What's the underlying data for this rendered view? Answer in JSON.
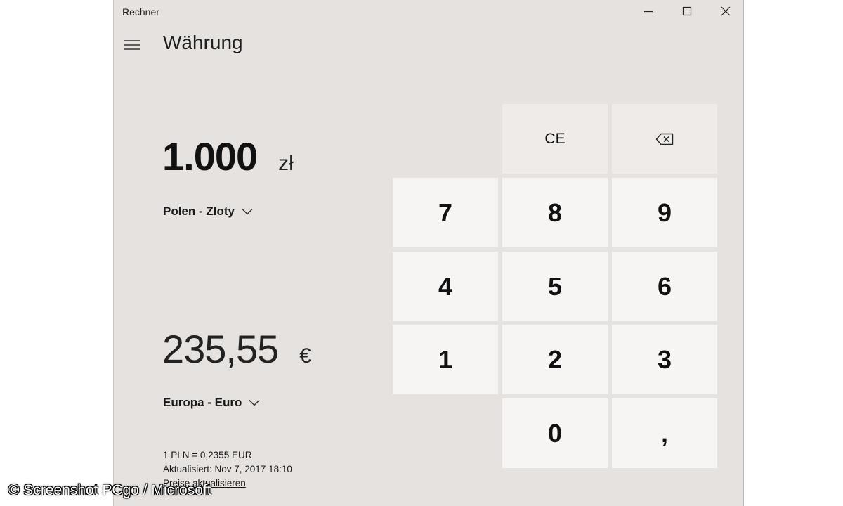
{
  "window": {
    "title": "Rechner",
    "page_title": "Währung"
  },
  "caption_icons": [
    "minimize-icon",
    "maximize-icon",
    "close-icon"
  ],
  "converter": {
    "from": {
      "value": "1.000",
      "unit": "zł",
      "currency": "Polen - Zloty"
    },
    "to": {
      "value": "235,55",
      "unit": "€",
      "currency": "Europa - Euro"
    },
    "rate": "1 PLN = 0,2355 EUR",
    "updated": "Aktualisiert: Nov 7, 2017 18:10",
    "refresh_link": "Preise aktualisieren"
  },
  "keypad": {
    "ce": "CE",
    "backspace_icon": "backspace-icon",
    "k7": "7",
    "k8": "8",
    "k9": "9",
    "k4": "4",
    "k5": "5",
    "k6": "6",
    "k1": "1",
    "k2": "2",
    "k3": "3",
    "k0": "0",
    "decimal": ","
  },
  "watermark": "© Screenshot PCgo / Microsoft"
}
